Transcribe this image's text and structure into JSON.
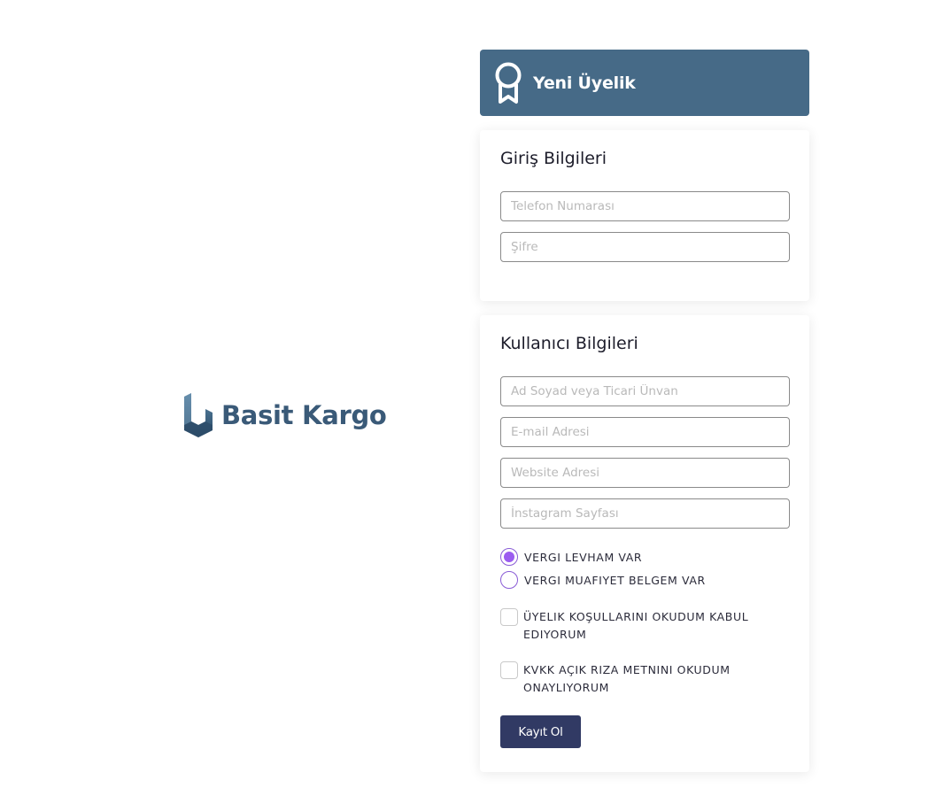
{
  "brand": {
    "name": "Basit Kargo",
    "logo_icon": "basit-kargo-logo-icon"
  },
  "header": {
    "icon": "award-ribbon-icon",
    "title": "Yeni Üyelik"
  },
  "login_section": {
    "title": "Giriş Bilgileri",
    "phone": {
      "placeholder": "Telefon Numarası",
      "value": ""
    },
    "password": {
      "placeholder": "Şifre",
      "value": ""
    }
  },
  "user_section": {
    "title": "Kullanıcı Bilgileri",
    "full_name": {
      "placeholder": "Ad Soyad veya Ticari Ünvan",
      "value": ""
    },
    "email": {
      "placeholder": "E-mail Adresi",
      "value": ""
    },
    "website": {
      "placeholder": "Website Adresi",
      "value": ""
    },
    "instagram": {
      "placeholder": "İnstagram Sayfası",
      "value": ""
    },
    "tax_options": [
      {
        "label": "VERGI LEVHAM VAR",
        "selected": true
      },
      {
        "label": "VERGI MUAFIYET BELGEM VAR",
        "selected": false
      }
    ],
    "agreements": [
      {
        "label": "ÜYELIK KOŞULLARINI OKUDUM KABUL EDIYORUM",
        "checked": false
      },
      {
        "label": "KVKK AÇIK RIZA METNINI OKUDUM ONAYLIYORUM",
        "checked": false
      }
    ],
    "submit_label": "Kayıt Ol"
  },
  "colors": {
    "header_bg": "#466a87",
    "brand_text": "#3a5a78",
    "radio_accent": "#9b5cf0",
    "button_bg": "#313a64"
  }
}
